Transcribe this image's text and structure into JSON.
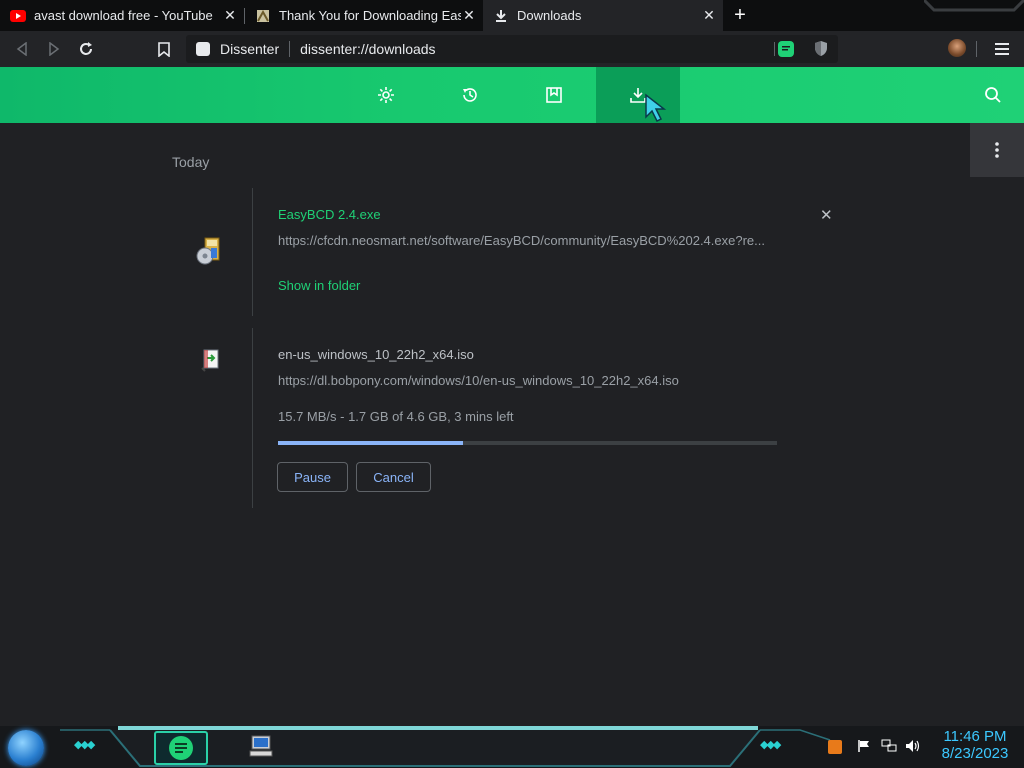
{
  "tabs": [
    {
      "title": "avast download free - YouTube",
      "favicon": "youtube-icon",
      "state": "inactive"
    },
    {
      "title": "Thank You for Downloading EasyBCD",
      "favicon": "easybcd-icon",
      "state": "inactive"
    },
    {
      "title": "Downloads",
      "favicon": "download-icon",
      "state": "active"
    }
  ],
  "omnibox": {
    "site_label": "Dissenter",
    "url": "dissenter://downloads"
  },
  "section_title": "Today",
  "downloads": [
    {
      "name": "EasyBCD 2.4.exe",
      "url": "https://cfcdn.neosmart.net/software/EasyBCD/community/EasyBCD%202.4.exe?re...",
      "action_link": "Show in folder",
      "icon": "installer-icon"
    },
    {
      "name": "en-us_windows_10_22h2_x64.iso",
      "url": "https://dl.bobpony.com/windows/10/en-us_windows_10_22h2_x64.iso",
      "status": "15.7 MB/s - 1.7 GB of 4.6 GB, 3 mins left",
      "progress": 0.37,
      "pause_label": "Pause",
      "cancel_label": "Cancel",
      "icon": "iso-file-icon"
    }
  ],
  "clock": {
    "time": "11:46 PM",
    "date": "8/23/2023"
  },
  "colors": {
    "accent": "#1fd176",
    "progress": "#8ab4f8",
    "background": "#202124"
  }
}
